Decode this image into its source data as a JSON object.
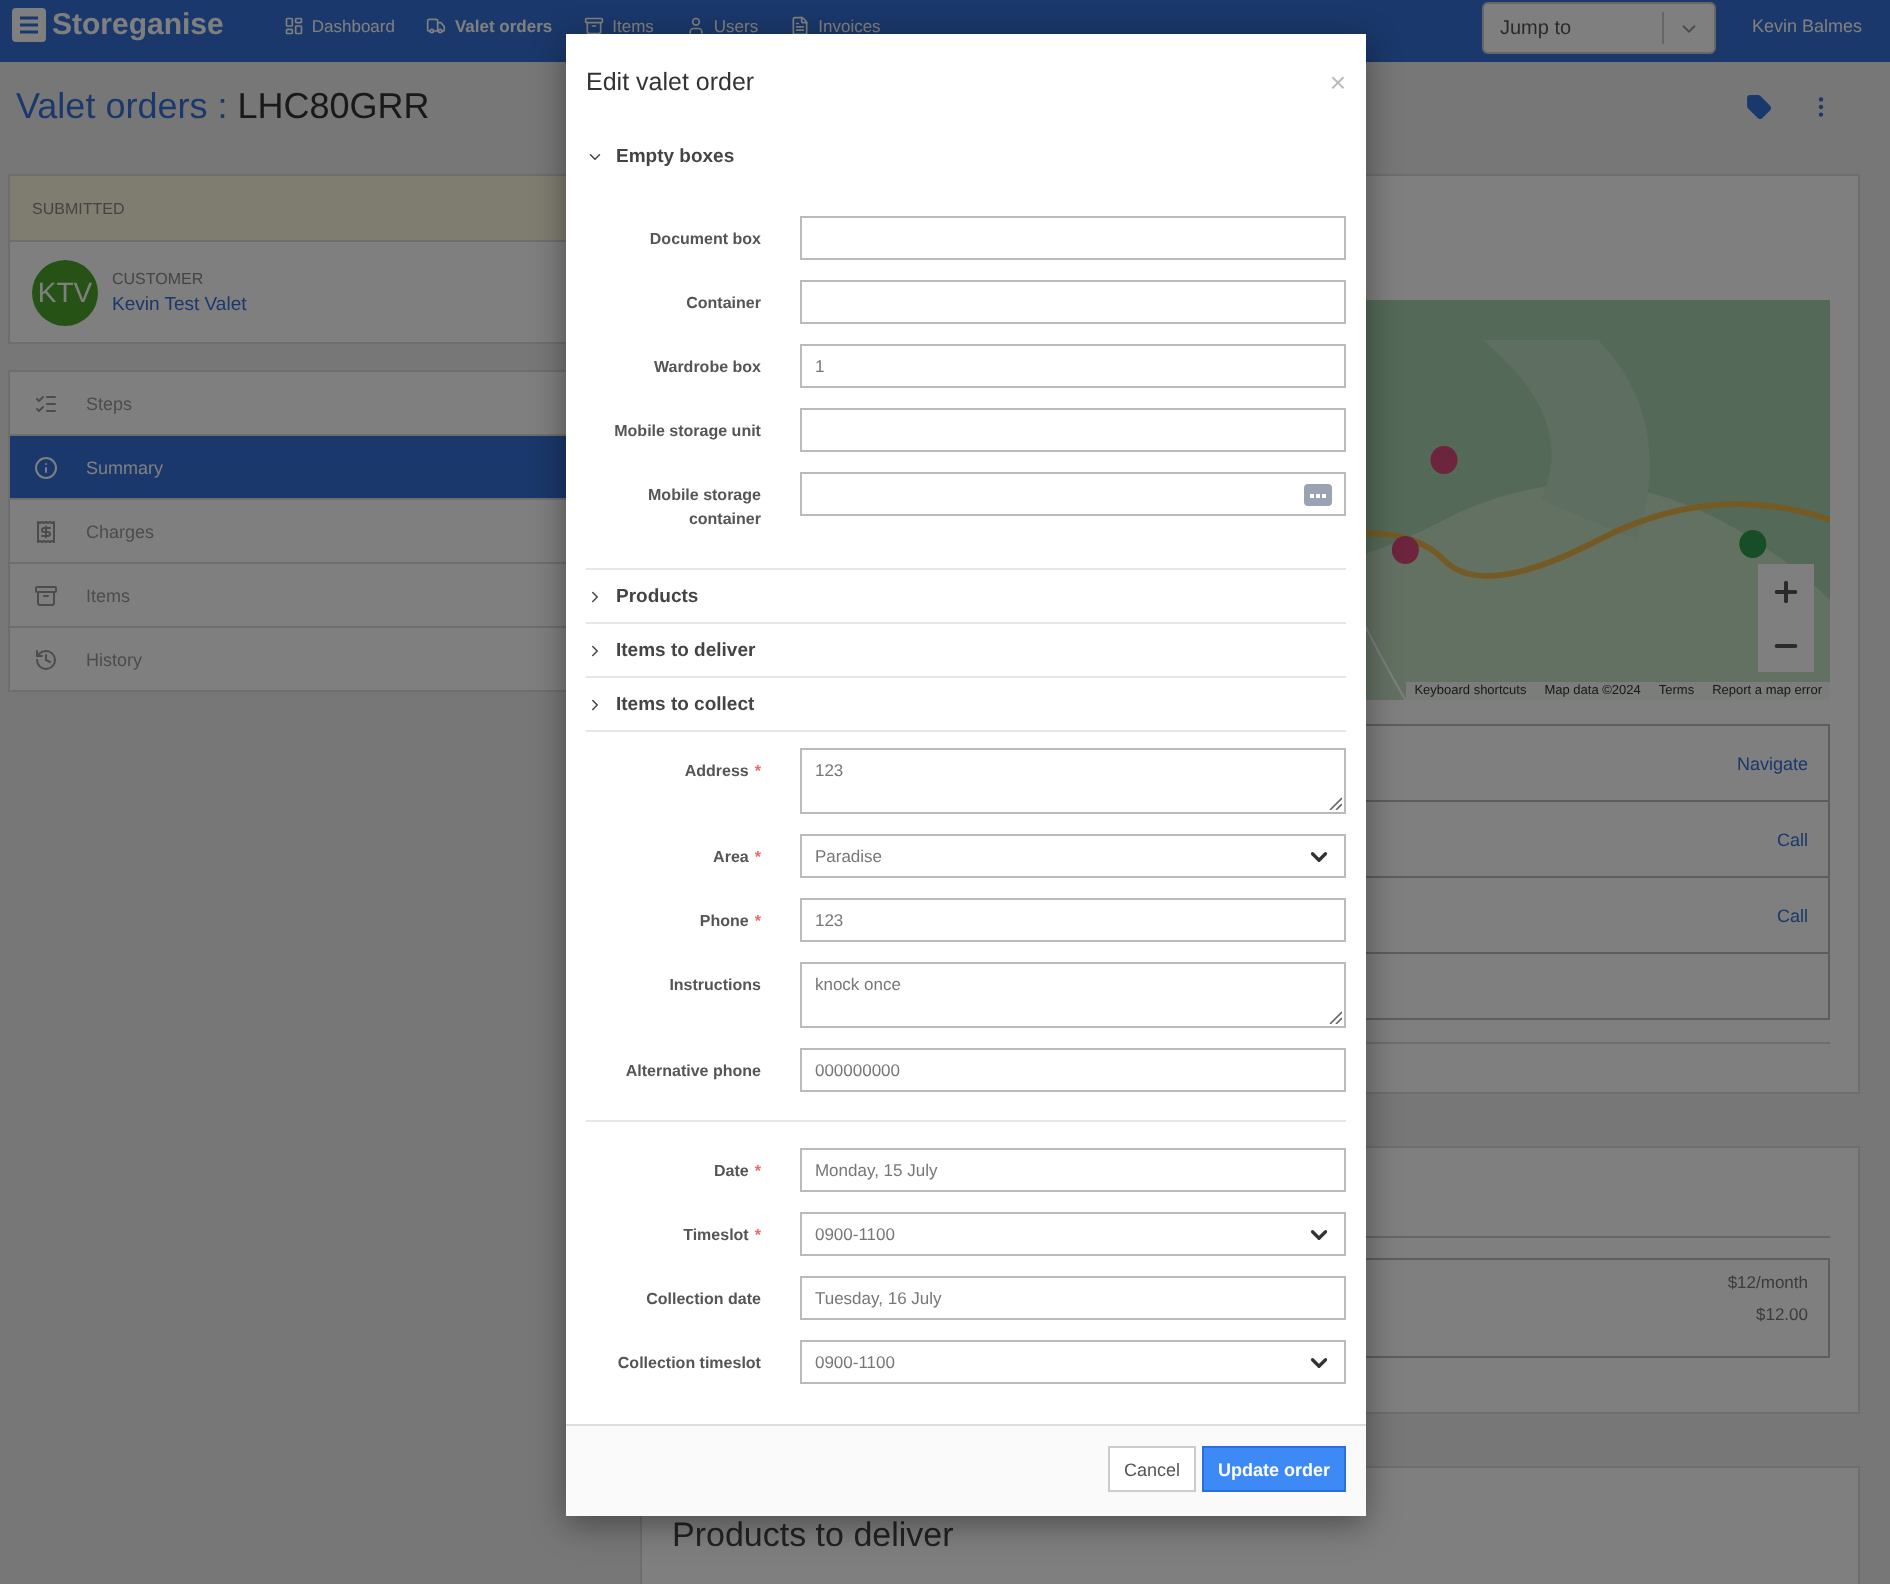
{
  "navbar": {
    "brand": "Storeganise",
    "links": [
      {
        "label": "Dashboard",
        "selected": false
      },
      {
        "label": "Valet orders",
        "selected": true
      },
      {
        "label": "Items",
        "selected": false
      },
      {
        "label": "Users",
        "selected": false
      },
      {
        "label": "Invoices",
        "selected": false
      }
    ],
    "jump_to": {
      "placeholder": "Jump to"
    },
    "user": "Kevin Balmes"
  },
  "page": {
    "title": "Valet orders",
    "separator": ":",
    "code": "LHC80GRR"
  },
  "sidebar": {
    "status": "SUBMITTED",
    "customer": {
      "initials": "KTV",
      "label": "CUSTOMER",
      "name": "Kevin Test Valet"
    },
    "items": [
      {
        "label": "Steps",
        "selected": false
      },
      {
        "label": "Summary",
        "selected": true
      },
      {
        "label": "Charges",
        "selected": false
      },
      {
        "label": "Items",
        "selected": false
      },
      {
        "label": "History",
        "selected": false
      }
    ]
  },
  "main": {
    "map": {
      "kind": "picture",
      "footer": [
        "Keyboard shortcuts",
        "Map data ©2024",
        "Terms",
        "Report a map error"
      ]
    },
    "contact_rows": [
      {
        "action": "Navigate"
      },
      {
        "action": "Call"
      },
      {
        "action": "Call"
      },
      {}
    ],
    "prices": [
      "$12/month",
      "$12.00"
    ],
    "next_heading": "Products to deliver"
  },
  "modal": {
    "title": "Edit valet order",
    "close": "×",
    "required_mark": "*",
    "sections": [
      {
        "label": "Empty boxes",
        "expanded": true,
        "fields": [
          {
            "label": "Document box"
          },
          {
            "label": "Container"
          },
          {
            "label": "Wardrobe box",
            "value": "1"
          },
          {
            "label": "Mobile storage unit"
          },
          {
            "label": "Mobile storage container",
            "kind": "picker"
          }
        ]
      },
      {
        "label": "Products",
        "expanded": false
      },
      {
        "label": "Items to deliver",
        "expanded": false
      },
      {
        "label": "Items to collect",
        "expanded": false
      }
    ],
    "address_fields": [
      {
        "label": "Address",
        "required": true,
        "kind": "textarea",
        "value": "123"
      },
      {
        "label": "Area",
        "required": true,
        "kind": "select",
        "value": "Paradise"
      },
      {
        "label": "Phone",
        "required": true,
        "kind": "text",
        "value": "123"
      },
      {
        "label": "Instructions",
        "required": false,
        "kind": "textarea",
        "value": "knock once"
      },
      {
        "label": "Alternative phone",
        "required": false,
        "kind": "text",
        "value": "000000000"
      }
    ],
    "schedule_fields": [
      {
        "label": "Date",
        "required": true,
        "kind": "text",
        "value": "Monday, 15 July"
      },
      {
        "label": "Timeslot",
        "required": true,
        "kind": "select",
        "value": "0900-1100"
      },
      {
        "label": "Collection date",
        "required": false,
        "kind": "text",
        "value": "Tuesday, 16 July"
      },
      {
        "label": "Collection timeslot",
        "required": false,
        "kind": "select",
        "value": "0900-1100"
      }
    ],
    "buttons": [
      {
        "label": "Cancel",
        "kind": "secondary"
      },
      {
        "label": "Update order",
        "kind": "primary"
      }
    ]
  }
}
